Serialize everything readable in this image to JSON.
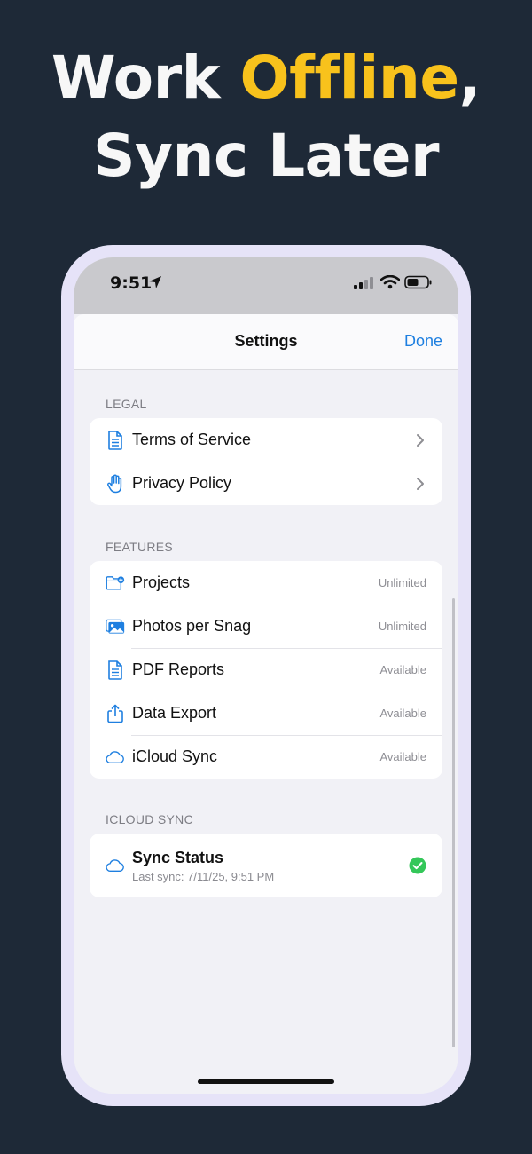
{
  "headline": {
    "line1_prefix": "Work ",
    "line1_accent": "Offline",
    "line1_suffix": ",",
    "line2": "Sync Later",
    "accent_color": "#f8c21c"
  },
  "status_bar": {
    "time": "9:51"
  },
  "nav": {
    "title": "Settings",
    "done_label": "Done"
  },
  "legal": {
    "header": "LEGAL",
    "items": [
      {
        "label": "Terms of Service",
        "icon": "document-icon"
      },
      {
        "label": "Privacy Policy",
        "icon": "hand-icon"
      }
    ]
  },
  "features": {
    "header": "FEATURES",
    "items": [
      {
        "label": "Projects",
        "value": "Unlimited",
        "icon": "folder-plus-icon"
      },
      {
        "label": "Photos per Snag",
        "value": "Unlimited",
        "icon": "photos-icon"
      },
      {
        "label": "PDF Reports",
        "value": "Available",
        "icon": "document-icon"
      },
      {
        "label": "Data Export",
        "value": "Available",
        "icon": "share-icon"
      },
      {
        "label": "iCloud Sync",
        "value": "Available",
        "icon": "cloud-icon"
      }
    ]
  },
  "icloud": {
    "header": "ICLOUD SYNC",
    "status_title": "Sync Status",
    "status_subtitle": "Last sync: 7/11/25, 9:51 PM"
  },
  "colors": {
    "accent_blue": "#1e7fe0",
    "success_green": "#34c759",
    "background": "#1e2937"
  }
}
